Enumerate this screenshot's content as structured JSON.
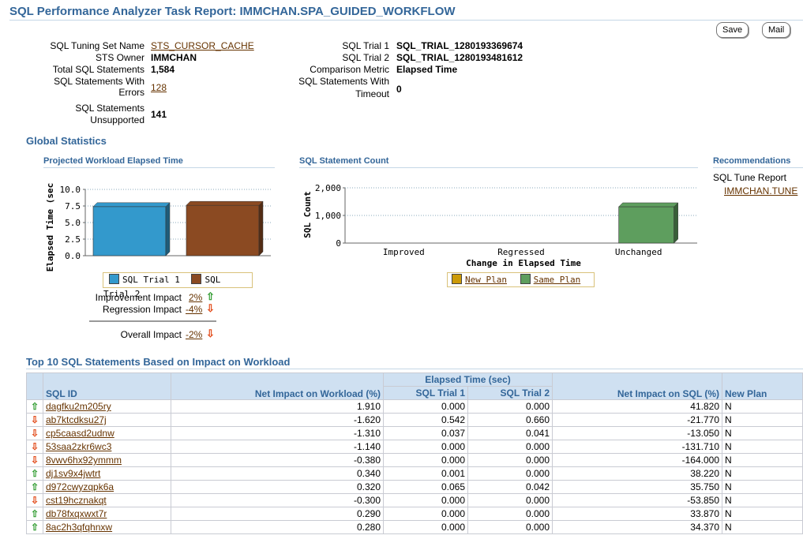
{
  "header": {
    "title": "SQL Performance Analyzer Task Report: IMMCHAN.SPA_GUIDED_WORKFLOW",
    "save_label": "Save",
    "mail_label": "Mail"
  },
  "summary": {
    "sts_name_label": "SQL Tuning Set Name",
    "sts_name": "STS_CURSOR_CACHE",
    "sts_owner_label": "STS Owner",
    "sts_owner": "IMMCHAN",
    "total_label": "Total SQL Statements",
    "total": "1,584",
    "errors_label_1": "SQL Statements With",
    "errors_label_2": "Errors",
    "errors": "128",
    "unsupported_label_1": "SQL Statements",
    "unsupported_label_2": "Unsupported",
    "unsupported": "141",
    "trial1_label": "SQL Trial 1",
    "trial1": "SQL_TRIAL_1280193369674",
    "trial2_label": "SQL Trial 2",
    "trial2": "SQL_TRIAL_1280193481612",
    "metric_label": "Comparison Metric",
    "metric": "Elapsed Time",
    "timeout_label_1": "SQL Statements With",
    "timeout_label_2": "Timeout",
    "timeout": "0"
  },
  "global_stats": {
    "title": "Global Statistics",
    "elapsed": {
      "title": "Projected Workload Elapsed Time",
      "ylabel": "Elapsed Time (sec",
      "yticks": [
        "10.0",
        "7.5",
        "5.0",
        "2.5",
        "0.0"
      ],
      "legend": [
        "SQL Trial 1",
        "SQL Trial 2"
      ],
      "colors": [
        "#3399cc",
        "#8b4a22"
      ],
      "improvement_label": "Improvement Impact",
      "improvement": "2%",
      "regression_label": "Regression Impact",
      "regression": "-4%",
      "overall_label": "Overall Impact",
      "overall": "-2%"
    },
    "count": {
      "title": "SQL Statement Count",
      "ylabel": "SQL Count",
      "yticks": [
        "2,000",
        "1,000",
        "0"
      ],
      "categories": [
        "Improved",
        "Regressed",
        "Unchanged"
      ],
      "xlabel": "Change in Elapsed Time",
      "legend": [
        "New Plan",
        "Same Plan"
      ],
      "colors": [
        "#cc9a06",
        "#5e9e5e"
      ]
    },
    "recommendations": {
      "title": "Recommendations",
      "label": "SQL Tune Report",
      "link": "IMMCHAN.TUNE"
    }
  },
  "chart_data": [
    {
      "type": "bar",
      "title": "Projected Workload Elapsed Time",
      "ylabel": "Elapsed Time (sec",
      "ylim": [
        0,
        10
      ],
      "categories": [
        ""
      ],
      "series": [
        {
          "name": "SQL Trial 1",
          "values": [
            7.4
          ]
        },
        {
          "name": "SQL Trial 2",
          "values": [
            7.6
          ]
        }
      ]
    },
    {
      "type": "bar",
      "title": "SQL Statement Count",
      "xlabel": "Change in Elapsed Time",
      "ylabel": "SQL Count",
      "ylim": [
        0,
        2000
      ],
      "categories": [
        "Improved",
        "Regressed",
        "Unchanged"
      ],
      "series": [
        {
          "name": "New Plan",
          "values": [
            0,
            0,
            0
          ]
        },
        {
          "name": "Same Plan",
          "values": [
            0,
            0,
            1315
          ]
        }
      ]
    }
  ],
  "top_sql": {
    "title": "Top 10 SQL Statements Based on Impact on Workload",
    "group_header": "Elapsed Time (sec)",
    "columns": [
      "SQL ID",
      "Net Impact on Workload (%)",
      "SQL Trial 1",
      "SQL Trial 2",
      "Net Impact on SQL (%)",
      "New Plan"
    ],
    "rows": [
      {
        "dir": "up",
        "arrow": "⇧",
        "sql_id": "dagfku2m205ry",
        "net_workload": "1.910",
        "trial1": "0.000",
        "trial2": "0.000",
        "net_sql": "41.820",
        "new_plan": "N"
      },
      {
        "dir": "dn",
        "arrow": "⇩",
        "sql_id": "ab7ktcdksu27j",
        "net_workload": "-1.620",
        "trial1": "0.542",
        "trial2": "0.660",
        "net_sql": "-21.770",
        "new_plan": "N"
      },
      {
        "dir": "dn",
        "arrow": "⇩",
        "sql_id": "cp5caasd2udnw",
        "net_workload": "-1.310",
        "trial1": "0.037",
        "trial2": "0.041",
        "net_sql": "-13.050",
        "new_plan": "N"
      },
      {
        "dir": "dn",
        "arrow": "⇩",
        "sql_id": "53saa2zkr6wc3",
        "net_workload": "-1.140",
        "trial1": "0.000",
        "trial2": "0.000",
        "net_sql": "-131.710",
        "new_plan": "N"
      },
      {
        "dir": "dn",
        "arrow": "⇩",
        "sql_id": "8vwv6hx92ymmm",
        "net_workload": "-0.380",
        "trial1": "0.000",
        "trial2": "0.000",
        "net_sql": "-164.000",
        "new_plan": "N"
      },
      {
        "dir": "up",
        "arrow": "⇧",
        "sql_id": "dj1sv9x4jwtrt",
        "net_workload": "0.340",
        "trial1": "0.001",
        "trial2": "0.000",
        "net_sql": "38.220",
        "new_plan": "N"
      },
      {
        "dir": "up",
        "arrow": "⇧",
        "sql_id": "d972cwyzqpk6a",
        "net_workload": "0.320",
        "trial1": "0.065",
        "trial2": "0.042",
        "net_sql": "35.750",
        "new_plan": "N"
      },
      {
        "dir": "dn",
        "arrow": "⇩",
        "sql_id": "cst19hcznakqt",
        "net_workload": "-0.300",
        "trial1": "0.000",
        "trial2": "0.000",
        "net_sql": "-53.850",
        "new_plan": "N"
      },
      {
        "dir": "up",
        "arrow": "⇧",
        "sql_id": "db78fxqxwxt7r",
        "net_workload": "0.290",
        "trial1": "0.000",
        "trial2": "0.000",
        "net_sql": "33.870",
        "new_plan": "N"
      },
      {
        "dir": "up",
        "arrow": "⇧",
        "sql_id": "8ac2h3qfqhnxw",
        "net_workload": "0.280",
        "trial1": "0.000",
        "trial2": "0.000",
        "net_sql": "34.370",
        "new_plan": "N"
      }
    ]
  }
}
